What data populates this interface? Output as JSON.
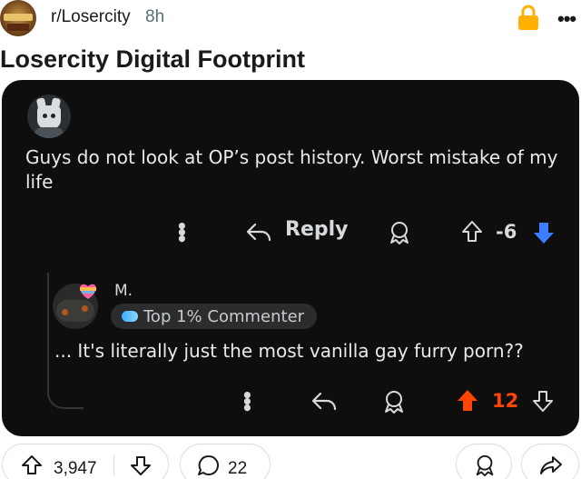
{
  "header": {
    "subreddit": "r/Losercity",
    "age": "8h",
    "icons": [
      "subreddit-avatar",
      "lock-icon",
      "more-options-icon"
    ],
    "lock_color": "#ffb000"
  },
  "post": {
    "title": "Losercity Digital Footprint"
  },
  "screenshot": {
    "background": "#0e0e0f",
    "comment1": {
      "text": "Guys do not look at OP’s post history. Worst mistake of my life",
      "reply_label": "Reply",
      "score": "-6",
      "vote_state": "downvoted",
      "downvote_color": "#3d7dff"
    },
    "comment2": {
      "username": "M.",
      "flair": "Top 1% Commenter",
      "text": "... It's literally just the most vanilla gay furry porn??",
      "score": "12",
      "vote_state": "upvoted",
      "upvote_color": "#ff4500"
    }
  },
  "footer": {
    "upvotes": "3,947",
    "comments": "22",
    "icons": [
      "upvote-icon",
      "downvote-icon",
      "comment-icon",
      "award-icon",
      "share-icon"
    ]
  }
}
